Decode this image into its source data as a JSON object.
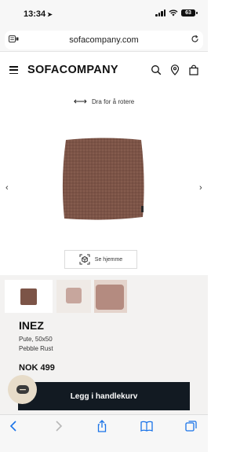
{
  "status_bar": {
    "time": "13:34",
    "battery": "63"
  },
  "url_bar": {
    "domain": "sofacompany.com"
  },
  "header": {
    "logo": "SOFACOMPANY"
  },
  "gallery": {
    "rotate_hint": "Dra for å rotere",
    "see_home_label": "Se hjemme"
  },
  "product": {
    "name": "INEZ",
    "description": "Pute, 50x50",
    "color": "Pebble Rust",
    "price": "NOK 499",
    "cart_button": "Legg i handlekurv"
  },
  "colors": {
    "pillow": "#7c5447",
    "button": "#121a22",
    "chat": "#e7dcc9"
  }
}
